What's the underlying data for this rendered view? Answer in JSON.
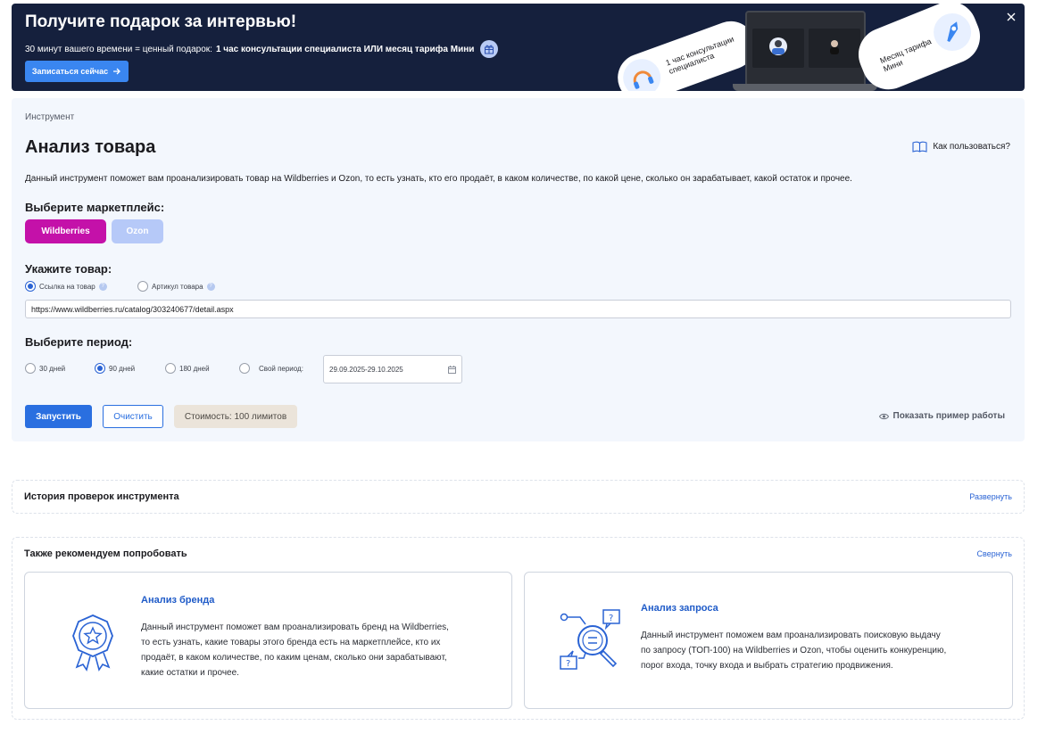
{
  "banner": {
    "title": "Получите подарок за интервью!",
    "subtitle_plain": "30 минут вашего времени = ценный подарок:",
    "subtitle_bold": "1 час консультации специалиста ИЛИ месяц тарифа Мини",
    "cta_label": "Записаться сейчас",
    "pill_consult": "1 час консультации специалиста",
    "pill_plan": "Месяц тарифа Мини"
  },
  "tool": {
    "breadcrumb": "Инструмент",
    "title": "Анализ товара",
    "howto_label": "Как пользоваться?",
    "description": "Данный инструмент поможет вам проанализировать товар на Wildberries и Ozon, то есть узнать, кто его продаёт, в каком количестве, по какой цене, сколько он зарабатывает, какой остаток и прочее.",
    "marketplace_label": "Выберите маркетплейс:",
    "marketplaces": [
      "Wildberries",
      "Ozon"
    ],
    "product_label": "Укажите товар:",
    "product_options": [
      "Ссылка на товар",
      "Артикул товара"
    ],
    "url_value": "https://www.wildberries.ru/catalog/303240677/detail.aspx",
    "period_label": "Выберите период:",
    "periods": [
      "30 дней",
      "90 дней",
      "180 дней",
      "Свой период:"
    ],
    "date_range": "29.09.2025-29.10.2025",
    "run_label": "Запустить",
    "clear_label": "Очистить",
    "cost_label": "Стоимость: 100 лимитов",
    "example_label": "Показать пример работы"
  },
  "history": {
    "title": "История проверок инструмента",
    "toggle": "Развернуть"
  },
  "recommend": {
    "title": "Также рекомендуем попробовать",
    "toggle": "Свернуть",
    "items": [
      {
        "title": "Анализ бренда",
        "lines": [
          "Данный инструмент поможет вам проанализировать бренд на Wildberries,",
          "то есть узнать, какие товары этого бренда есть на маркетплейсе, кто их",
          "продаёт, в каком количестве, по каким ценам, сколько они зарабатывают,",
          "какие остатки и прочее."
        ]
      },
      {
        "title": "Анализ запроса",
        "lines": [
          "Данный инструмент поможем вам проанализировать поисковую выдачу",
          "по запросу (ТОП-100) на Wildberries и Ozon, чтобы оценить конкуренцию,",
          "порог входа, точку входа и выбрать стратегию продвижения."
        ]
      }
    ]
  },
  "colors": {
    "banner_bg": "#15203d",
    "accent": "#2a6fe0",
    "wildberries": "#c411a9",
    "ozon": "#b6c9f8",
    "panel_bg": "#f3f7fd"
  }
}
